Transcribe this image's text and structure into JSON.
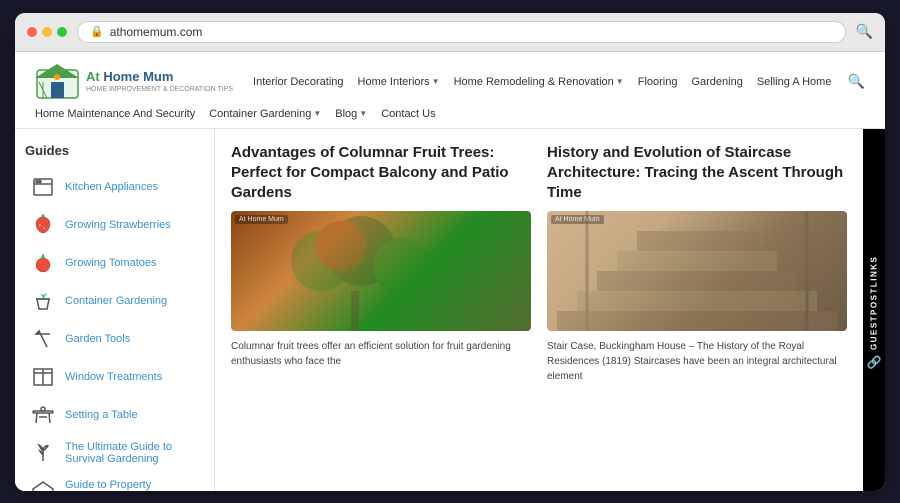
{
  "browser": {
    "address": "athomemum.com",
    "dots": [
      "red",
      "yellow",
      "green"
    ]
  },
  "site": {
    "logo": {
      "at": "At ",
      "home": "Home ",
      "mum": "Mum",
      "subtext": "HOME IMPROVEMENT & DECORATION TIPS"
    },
    "nav": {
      "row1": [
        {
          "label": "Interior Decorating",
          "has_dropdown": false
        },
        {
          "label": "Home Interiors",
          "has_dropdown": true
        },
        {
          "label": "Home Remodeling & Renovation",
          "has_dropdown": true
        },
        {
          "label": "Flooring",
          "has_dropdown": false
        },
        {
          "label": "Gardening",
          "has_dropdown": false
        },
        {
          "label": "Selling A Home",
          "has_dropdown": false
        }
      ],
      "row2": [
        {
          "label": "Home Maintenance And Security",
          "has_dropdown": false
        },
        {
          "label": "Container Gardening",
          "has_dropdown": true
        },
        {
          "label": "Blog",
          "has_dropdown": true
        },
        {
          "label": "Contact Us",
          "has_dropdown": false
        }
      ]
    }
  },
  "sidebar": {
    "title": "Guides",
    "items": [
      {
        "label": "Kitchen Appliances",
        "icon": "🍳"
      },
      {
        "label": "Growing Strawberries",
        "icon": "🍓"
      },
      {
        "label": "Growing Tomatoes",
        "icon": "🍅"
      },
      {
        "label": "Container Gardening",
        "icon": "🪴"
      },
      {
        "label": "Garden Tools",
        "icon": "🔧"
      },
      {
        "label": "Window Treatments",
        "icon": "🪟"
      },
      {
        "label": "Setting a Table",
        "icon": "🍽️"
      },
      {
        "label": "The Ultimate Guide to Survival Gardening",
        "icon": "🌱"
      },
      {
        "label": "Guide to Property Inspections",
        "icon": "🏠"
      }
    ]
  },
  "articles": [
    {
      "title": "Advantages of Columnar Fruit Trees: Perfect for Compact Balcony and Patio Gardens",
      "image_type": "fruits",
      "watermark": "At Home Mum",
      "excerpt": "Columnar fruit trees offer an efficient solution for fruit gardening enthusiasts who face the"
    },
    {
      "title": "History and Evolution of Staircase Architecture: Tracing the Ascent Through Time",
      "image_type": "stairs",
      "watermark": "At Home Mum",
      "excerpt": "Stair Case, Buckingham House – The History of the Royal Residences (1819) Staircases have been an integral architectural element"
    }
  ],
  "right_band": {
    "label": "GUESTPOSTLINKS",
    "icon": "🔗"
  }
}
